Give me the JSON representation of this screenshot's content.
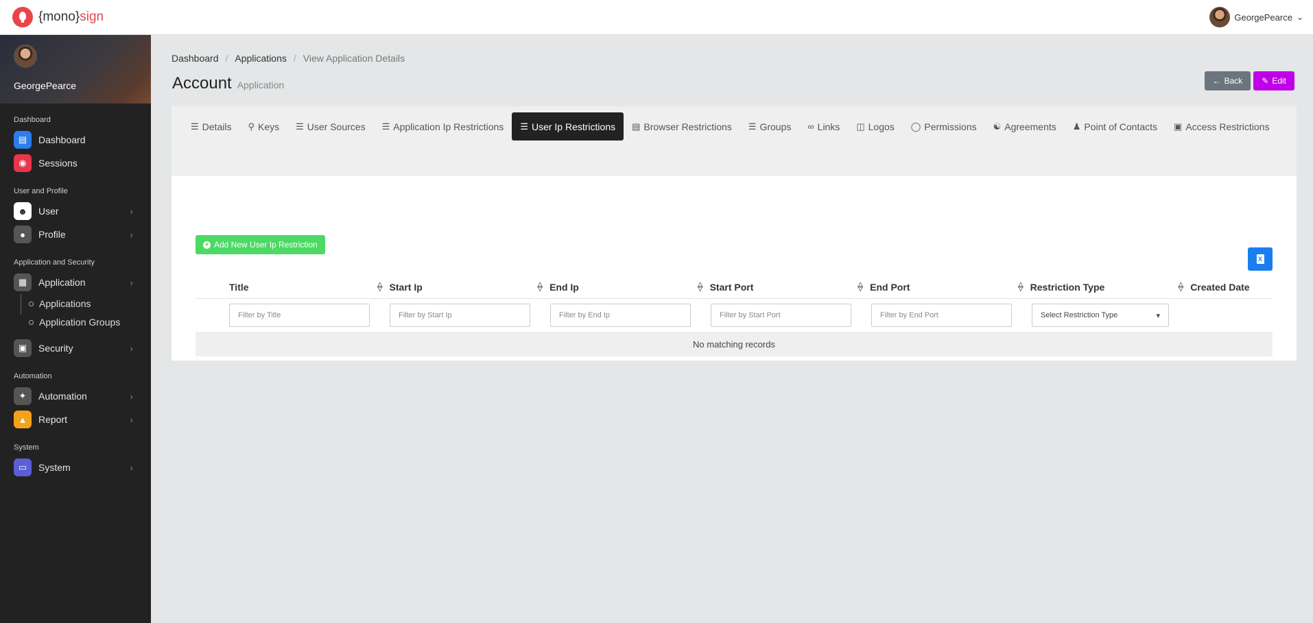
{
  "topbar": {
    "logo_prefix": "{mono}",
    "logo_accent": "sign",
    "username": "GeorgePearce"
  },
  "sidebar": {
    "profile_name": "GeorgePearce",
    "sections": {
      "dashboard": "Dashboard",
      "user_profile": "User and Profile",
      "app_security": "Application and Security",
      "automation": "Automation",
      "system": "System"
    },
    "items": {
      "dashboard": "Dashboard",
      "sessions": "Sessions",
      "user": "User",
      "profile": "Profile",
      "application": "Application",
      "applications": "Applications",
      "application_groups": "Application Groups",
      "security": "Security",
      "automation": "Automation",
      "report": "Report",
      "system": "System"
    }
  },
  "breadcrumb": {
    "items": [
      "Dashboard",
      "Applications",
      "View Application Details"
    ]
  },
  "page": {
    "title": "Account",
    "subtitle": "Application",
    "back_label": "Back",
    "edit_label": "Edit"
  },
  "tabs": [
    {
      "label": "Details",
      "icon": "list-icon"
    },
    {
      "label": "Keys",
      "icon": "key-icon"
    },
    {
      "label": "User Sources",
      "icon": "list-icon"
    },
    {
      "label": "Application Ip Restrictions",
      "icon": "list-icon"
    },
    {
      "label": "User Ip Restrictions",
      "icon": "list-icon",
      "active": true
    },
    {
      "label": "Browser Restrictions",
      "icon": "browser-icon"
    },
    {
      "label": "Groups",
      "icon": "list-icon"
    },
    {
      "label": "Links",
      "icon": "link-icon"
    },
    {
      "label": "Logos",
      "icon": "images-icon"
    },
    {
      "label": "Permissions",
      "icon": "toggle-icon"
    },
    {
      "label": "Agreements",
      "icon": "handshake-icon"
    },
    {
      "label": "Point of Contacts",
      "icon": "users-icon"
    },
    {
      "label": "Access Restrictions",
      "icon": "unlock-icon"
    }
  ],
  "content": {
    "add_label": "Add New User Ip Restriction",
    "no_records": "No matching records"
  },
  "table": {
    "columns": [
      "Title",
      "Start Ip",
      "End Ip",
      "Start Port",
      "End Port",
      "Restriction Type",
      "Created Date"
    ],
    "filters": {
      "title": "Filter by Title",
      "start_ip": "Filter by Start Ip",
      "end_ip": "Filter by End Ip",
      "start_port": "Filter by Start Port",
      "end_port": "Filter by End Port",
      "restriction_type": "Select Restriction Type"
    }
  },
  "colors": {
    "active_tab": "#222222",
    "add_button": "#4cd964",
    "edit_button": "#c000e8",
    "excel_button": "#1a7df0"
  }
}
